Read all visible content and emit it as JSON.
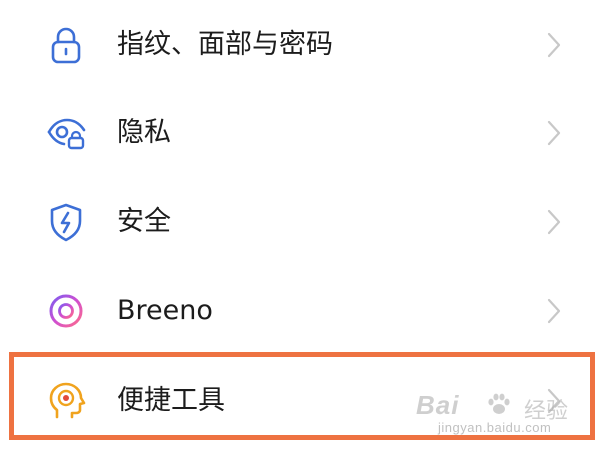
{
  "settings_list": [
    {
      "label": "指纹、面部与密码",
      "icon": "lock-icon",
      "icon_color": "#3d6fd6"
    },
    {
      "label": "隐私",
      "icon": "privacy-eye-lock-icon",
      "icon_color": "#3d6fd6"
    },
    {
      "label": "安全",
      "icon": "shield-bolt-icon",
      "icon_color": "#3d6fd6"
    },
    {
      "label": "Breeno",
      "icon": "breeno-ring-icon",
      "icon_color": "#c94fd6"
    },
    {
      "label": "便捷工具",
      "icon": "head-target-icon",
      "icon_color": "#f0a31e"
    }
  ],
  "highlight": {
    "target": "便捷工具",
    "color": "#ee7241"
  },
  "watermark": {
    "brand": "Bai",
    "text": "经验",
    "url": "jingyan.baidu.com"
  },
  "colors": {
    "chevron": "#c8c8c8",
    "text": "#1c1c1c",
    "background": "#ffffff"
  }
}
